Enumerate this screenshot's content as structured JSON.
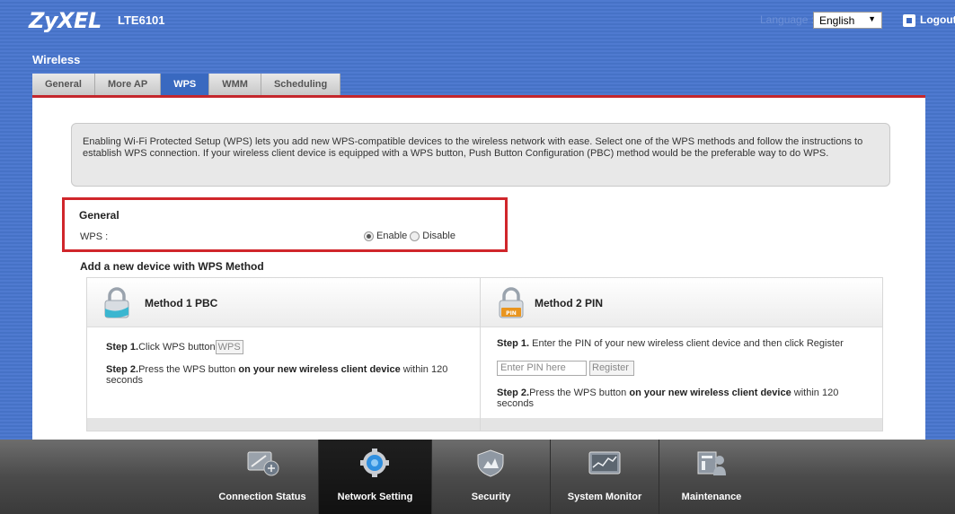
{
  "header": {
    "brand": "ZyXEL",
    "model": "LTE6101",
    "language_label": "Language :",
    "language_value": "English",
    "logout_label": "Logout"
  },
  "page": {
    "section_title": "Wireless",
    "tabs": [
      {
        "label": "General",
        "active": false
      },
      {
        "label": "More AP",
        "active": false
      },
      {
        "label": "WPS",
        "active": true
      },
      {
        "label": "WMM",
        "active": false
      },
      {
        "label": "Scheduling",
        "active": false
      }
    ]
  },
  "info": {
    "text": "Enabling Wi-Fi Protected Setup (WPS) lets you add new WPS-compatible devices to the wireless network with ease. Select one of the WPS methods and follow the instructions to establish WPS connection. If your wireless client device is equipped with a WPS button, Push Button Configuration (PBC) method would be the preferable way to do WPS."
  },
  "general": {
    "title": "General",
    "wps_label": "WPS :",
    "options": [
      {
        "label": "Enable",
        "checked": true
      },
      {
        "label": "Disable",
        "checked": false
      }
    ]
  },
  "add_device": {
    "title": "Add a new device with WPS Method",
    "method1": {
      "title": "Method 1 PBC",
      "step1_bold": "Step 1.",
      "step1_text": "Click WPS button",
      "step1_button": "WPS",
      "step2_bold": "Step 2.",
      "step2_text": "Press the WPS button ",
      "step2_emph": "on your new wireless client device",
      "step2_tail": " within 120 seconds"
    },
    "method2": {
      "title": "Method 2 PIN",
      "lock_badge": "PIN",
      "step1_bold": "Step 1.",
      "step1_text": " Enter the PIN of your new wireless client device and then click Register",
      "pin_placeholder": "Enter PIN here",
      "register_button": "Register",
      "step2_bold": "Step 2.",
      "step2_text": "Press the WPS button  ",
      "step2_emph": "on your new wireless client device",
      "step2_tail": " within 120 seconds"
    }
  },
  "bottom_nav": [
    {
      "label": "Connection Status",
      "icon": "connection-status-icon",
      "active": false
    },
    {
      "label": "Network Setting",
      "icon": "gear-icon",
      "active": true
    },
    {
      "label": "Security",
      "icon": "shield-icon",
      "active": false
    },
    {
      "label": "System Monitor",
      "icon": "monitor-chart-icon",
      "active": false
    },
    {
      "label": "Maintenance",
      "icon": "maintenance-icon",
      "active": false
    }
  ],
  "colors": {
    "header_blue": "#4a74c5",
    "active_tab": "#3969c0",
    "accent_red": "#c4272c",
    "nav_dark": "#3a3a3a"
  }
}
